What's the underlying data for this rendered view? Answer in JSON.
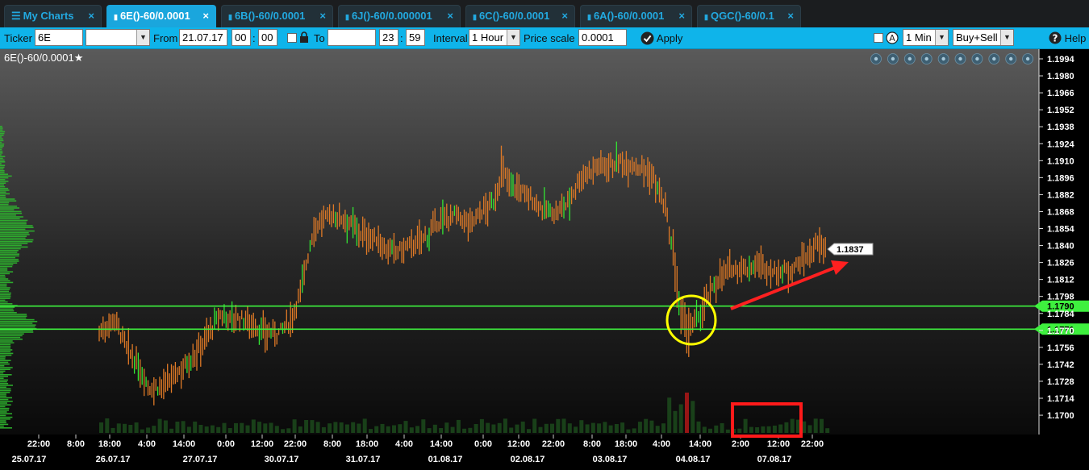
{
  "tabs": [
    {
      "label": "My Charts",
      "icon": "menu-icon",
      "active": false
    },
    {
      "label": "6E()-60/0.0001",
      "icon": "bar-chart-icon",
      "active": true
    },
    {
      "label": "6B()-60/0.0001",
      "icon": "bar-chart-icon",
      "active": false
    },
    {
      "label": "6J()-60/0.000001",
      "icon": "bar-chart-icon",
      "active": false
    },
    {
      "label": "6C()-60/0.0001",
      "icon": "bar-chart-icon",
      "active": false
    },
    {
      "label": "6A()-60/0.0001",
      "icon": "bar-chart-icon",
      "active": false
    },
    {
      "label": "QGC()-60/0.1",
      "icon": "bar-chart-icon",
      "active": false
    }
  ],
  "tab_close": "×",
  "toolbar": {
    "ticker_label": "Ticker",
    "ticker_value": "6E",
    "from_label": "From",
    "from_date": "21.07.17",
    "from_hour": "00",
    "from_min": "00",
    "to_label": "To",
    "to_date": "",
    "to_hour": "23",
    "to_min": "59",
    "time_sep": ":",
    "interval_label": "Interval",
    "interval_value": "1 Hour",
    "price_scale_label": "Price scale",
    "price_scale_value": "0.0001",
    "apply_label": "Apply",
    "tick_value": "1 Min",
    "side_value": "Buy+Sell",
    "help_label": "Help"
  },
  "chart_title": "6E()-60/0.0001★",
  "colors": {
    "accent": "#0fb4ea",
    "bar": "#e07a26",
    "bar_highlight": "#33e633",
    "level_line": "#3ef03e",
    "marker_circle": "#ffff00",
    "arrow": "#ff2020",
    "box": "#ff1a1a"
  },
  "chart_data": {
    "type": "bar",
    "y_ticks": [
      "1.1994",
      "1.1980",
      "1.1966",
      "1.1952",
      "1.1938",
      "1.1924",
      "1.1910",
      "1.1896",
      "1.1882",
      "1.1868",
      "1.1854",
      "1.1840",
      "1.1826",
      "1.1812",
      "1.1798",
      "1.1784",
      "1.1770",
      "1.1756",
      "1.1742",
      "1.1728",
      "1.1714",
      "1.1700"
    ],
    "ylim": [
      1.169,
      1.2
    ],
    "levels": [
      {
        "value": 1.179,
        "label": "1.1790"
      },
      {
        "value": 1.1771,
        "label": "1.1771"
      }
    ],
    "last_price": {
      "value": 1.1837,
      "label": "1.1837"
    },
    "x_time_labels": [
      "22:00",
      "8:00",
      "18:00",
      "4:00",
      "14:00",
      "0:00",
      "12:00",
      "22:00",
      "8:00",
      "18:00",
      "4:00",
      "14:00",
      "0:00",
      "12:00",
      "22:00",
      "8:00",
      "18:00",
      "4:00",
      "14:00",
      "2:00",
      "12:00",
      "22:00"
    ],
    "x_date_labels": [
      "25.07.17",
      "26.07.17",
      "27.07.17",
      "30.07.17",
      "31.07.17",
      "01.08.17",
      "02.08.17",
      "03.08.17",
      "04.08.17",
      "07.08.17"
    ],
    "price_path": [
      [
        0,
        1.1768
      ],
      [
        8,
        1.178
      ],
      [
        14,
        1.1755
      ],
      [
        20,
        1.174
      ],
      [
        26,
        1.1722
      ],
      [
        34,
        1.1725
      ],
      [
        42,
        1.1738
      ],
      [
        50,
        1.1752
      ],
      [
        56,
        1.1768
      ],
      [
        62,
        1.1782
      ],
      [
        68,
        1.178
      ],
      [
        76,
        1.1778
      ],
      [
        84,
        1.1768
      ],
      [
        92,
        1.1768
      ],
      [
        98,
        1.1778
      ],
      [
        103,
        1.1802
      ],
      [
        110,
        1.1855
      ],
      [
        118,
        1.1865
      ],
      [
        126,
        1.1862
      ],
      [
        134,
        1.185
      ],
      [
        142,
        1.1845
      ],
      [
        148,
        1.1835
      ],
      [
        154,
        1.1836
      ],
      [
        162,
        1.1842
      ],
      [
        168,
        1.1848
      ],
      [
        174,
        1.186
      ],
      [
        182,
        1.1865
      ],
      [
        190,
        1.1858
      ],
      [
        196,
        1.1868
      ],
      [
        202,
        1.1875
      ],
      [
        206,
        1.19
      ],
      [
        212,
        1.189
      ],
      [
        220,
        1.188
      ],
      [
        228,
        1.187
      ],
      [
        234,
        1.1866
      ],
      [
        240,
        1.1875
      ],
      [
        246,
        1.1895
      ],
      [
        254,
        1.1905
      ],
      [
        262,
        1.1908
      ],
      [
        270,
        1.1908
      ],
      [
        278,
        1.1905
      ],
      [
        284,
        1.1895
      ],
      [
        290,
        1.187
      ],
      [
        294,
        1.183
      ],
      [
        298,
        1.178
      ],
      [
        302,
        1.177
      ],
      [
        306,
        1.1778
      ],
      [
        312,
        1.1798
      ],
      [
        318,
        1.1815
      ],
      [
        326,
        1.1822
      ],
      [
        332,
        1.182
      ],
      [
        338,
        1.1825
      ],
      [
        344,
        1.1818
      ],
      [
        350,
        1.1818
      ],
      [
        356,
        1.1822
      ],
      [
        362,
        1.183
      ],
      [
        368,
        1.184
      ],
      [
        372,
        1.1838
      ]
    ]
  }
}
